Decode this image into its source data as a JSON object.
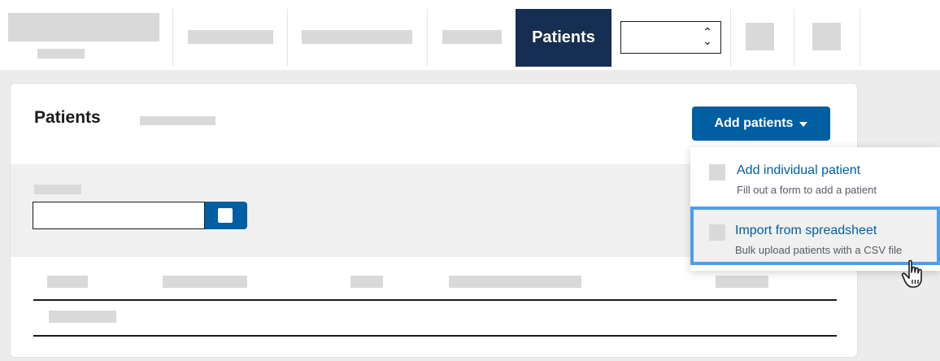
{
  "nav": {
    "active_tab": "Patients",
    "select_value": "",
    "select_chevron": "⌃⌄"
  },
  "card": {
    "title": "Patients",
    "add_button_label": "Add patients",
    "add_button_icon": "caret-down-icon"
  },
  "dropdown": {
    "items": [
      {
        "title": "Add individual patient",
        "description": "Fill out a form to add a patient",
        "icon": "person-icon"
      },
      {
        "title": "Import from spreadsheet",
        "description": "Bulk upload patients with a CSV file",
        "icon": "spreadsheet-icon"
      }
    ]
  },
  "colors": {
    "primary": "#005ea2",
    "nav_active": "#162e51",
    "highlight_border": "#4d9ee8"
  },
  "cursor": "hand-pointer-icon"
}
